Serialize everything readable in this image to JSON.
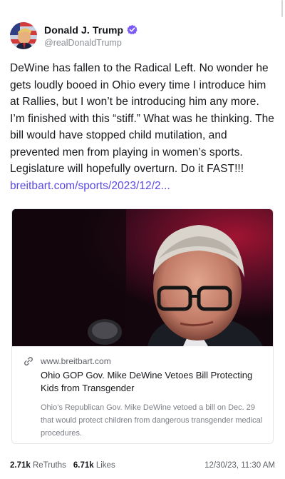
{
  "post": {
    "author": {
      "display_name": "Donald J. Trump",
      "handle": "@realDonaldTrump",
      "verified_icon": "verified-badge-icon",
      "verified_color": "#7c5cf5"
    },
    "text": "DeWine has fallen to the Radical Left. No wonder he gets loudly booed in Ohio every time I introduce him at Rallies, but I won’t be introducing him any more. I’m finished with this “stiff.” What was he thinking. The bill would have stopped child mutilation, and prevented men from playing in women’s sports. Legislature will hopefully overturn. Do it FAST!!! ",
    "link_text": "breitbart.com/sports/2023/12/2...",
    "link_color": "#5a48e6",
    "card": {
      "image_alt": "photo-of-man-in-glasses-at-microphone",
      "link_icon": "link-icon",
      "domain": "www.breitbart.com",
      "title": "Ohio GOP Gov. Mike DeWine Vetoes Bill Protecting Kids from Transgender",
      "description": "Ohio’s Republican Gov. Mike DeWine vetoed a bill on Dec. 29 that would protect children from dangerous transgender medical procedures."
    },
    "stats": {
      "retruths_count": "2.71k",
      "retruths_label": "ReTruths",
      "likes_count": "6.71k",
      "likes_label": "Likes"
    },
    "timestamp": "12/30/23, 11:30 AM"
  }
}
